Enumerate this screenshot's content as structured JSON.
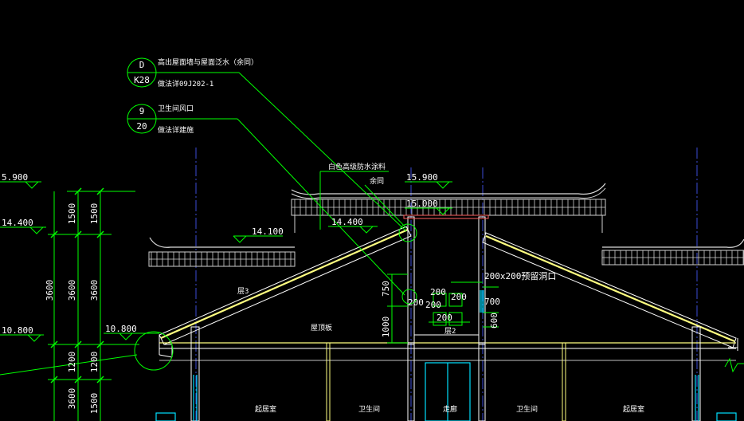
{
  "colors": {
    "background": "#000000",
    "leader": "#00ff00",
    "text": "#ffffff",
    "roof_edge": "#ffff80",
    "axis": "#3b4bd6",
    "wall": "#ffffff",
    "glass": "#00e0ff",
    "brick": "#cfcfcf"
  },
  "callouts": [
    {
      "top": "D",
      "bottom": "K28",
      "line1": "高出屋面墙与屋面泛水（余同）",
      "line2": "做法详09J202-1"
    },
    {
      "top": "9",
      "bottom": "20",
      "line1": "卫生间风口",
      "line2": "做法详建施"
    }
  ],
  "notes": {
    "waterproof": "白色高级防水涂料",
    "same": "余同",
    "vent_size": "200x200预留洞口"
  },
  "elevations": {
    "left_1": "5.900",
    "left_2": "14.400",
    "left_3": "10.800",
    "left_4": "10.800",
    "mid_1": "14.100",
    "mid_2": "14.400",
    "top_1": "15.900",
    "top_2": "15.000"
  },
  "dimensions": {
    "left_a": [
      "1500",
      "3600",
      "1200",
      "3600"
    ],
    "left_b": [
      "1500",
      "3600",
      "1200",
      "1500"
    ],
    "mid": [
      "750",
      "1000"
    ],
    "vent": [
      "200",
      "200",
      "200",
      "200",
      "200",
      "700",
      "600"
    ]
  },
  "room_labels": {
    "floor3": "层3",
    "floor2": "层2",
    "slab": "屋顶板",
    "room1": "起居室",
    "room2": "卫生间",
    "room3": "走廊",
    "room4": "卫生间",
    "room5": "起居室"
  }
}
